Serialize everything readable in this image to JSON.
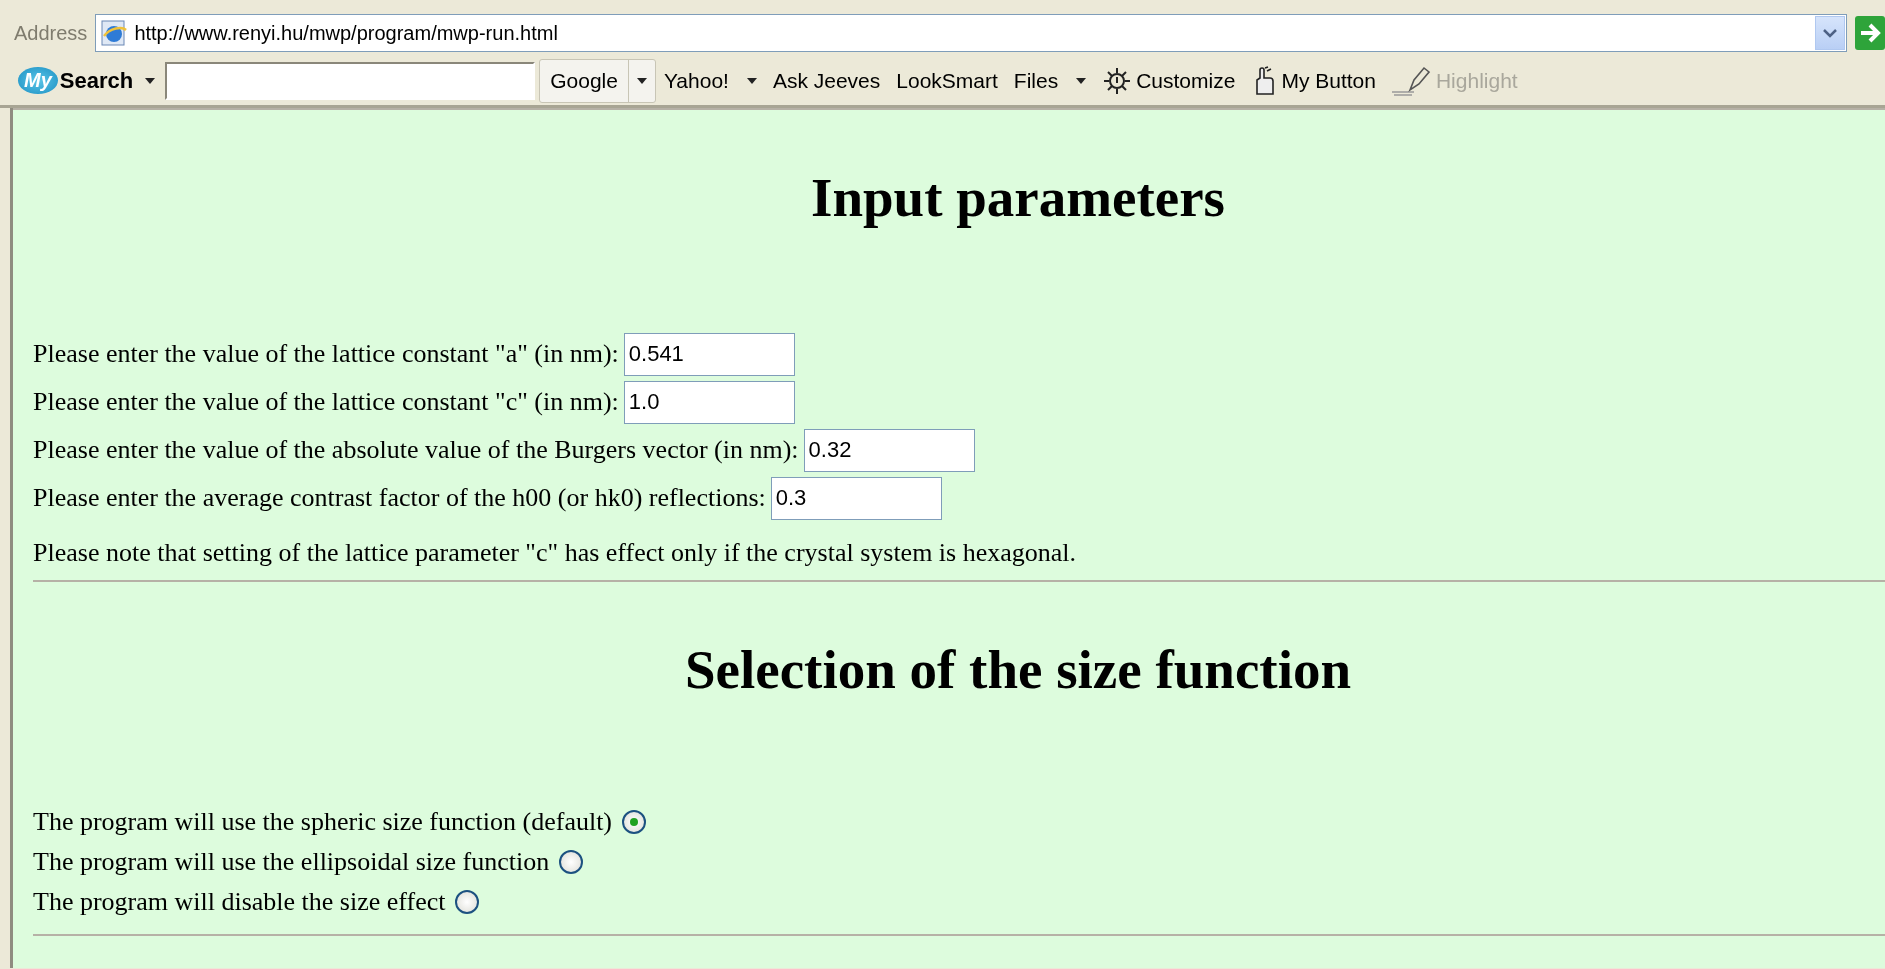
{
  "address_bar": {
    "label": "Address",
    "url": "http://www.renyi.hu/mwp/program/mwp-run.html"
  },
  "toolbar": {
    "brand": {
      "logo": "My",
      "label": "Search"
    },
    "items": [
      {
        "label": "Google",
        "kind": "split"
      },
      {
        "label": "Yahoo!",
        "kind": "menu"
      },
      {
        "label": "Ask Jeeves",
        "kind": "plain"
      },
      {
        "label": "LookSmart",
        "kind": "plain"
      },
      {
        "label": "Files",
        "kind": "menu"
      },
      {
        "label": "Customize",
        "kind": "gear"
      },
      {
        "label": "My Button",
        "kind": "hand"
      },
      {
        "label": "Highlight",
        "kind": "pen",
        "disabled": true
      }
    ]
  },
  "sections": [
    {
      "title": "Input parameters",
      "fields": [
        {
          "label": "Please enter the value of the lattice constant \"a\" (in nm):",
          "value": "0.541"
        },
        {
          "label": "Please enter the value of the lattice constant \"c\" (in nm):",
          "value": "1.0"
        },
        {
          "label": "Please enter the value of the absolute value of the Burgers vector (in nm):",
          "value": "0.32"
        },
        {
          "label": "Please enter the average contrast factor of the h00 (or hk0) reflections:",
          "value": "0.3"
        }
      ],
      "note": "Please note that setting of the lattice parameter \"c\" has effect only if the crystal system is hexagonal."
    },
    {
      "title": "Selection of the size function",
      "options": [
        {
          "label": "The program will use the spheric size function (default)",
          "selected": true
        },
        {
          "label": "The program will use the ellipsoidal size function",
          "selected": false
        },
        {
          "label": "The program will disable the size effect",
          "selected": false
        }
      ]
    }
  ]
}
